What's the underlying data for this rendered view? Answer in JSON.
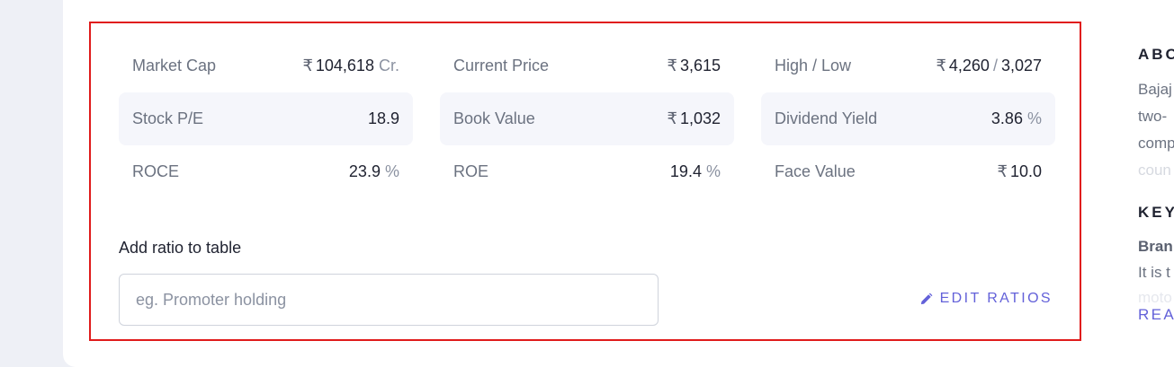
{
  "ratios": {
    "row1": {
      "c1": {
        "name": "Market Cap",
        "currency": "₹",
        "value": "104,618",
        "unit": "Cr."
      },
      "c2": {
        "name": "Current Price",
        "currency": "₹",
        "value": "3,615"
      },
      "c3": {
        "name": "High / Low",
        "currency": "₹",
        "high": "4,260",
        "sep": "/",
        "low": "3,027"
      }
    },
    "row2": {
      "c1": {
        "name": "Stock P/E",
        "value": "18.9"
      },
      "c2": {
        "name": "Book Value",
        "currency": "₹",
        "value": "1,032"
      },
      "c3": {
        "name": "Dividend Yield",
        "value": "3.86",
        "unit": "%"
      }
    },
    "row3": {
      "c1": {
        "name": "ROCE",
        "value": "23.9",
        "unit": "%"
      },
      "c2": {
        "name": "ROE",
        "value": "19.4",
        "unit": "%"
      },
      "c3": {
        "name": "Face Value",
        "currency": "₹",
        "value": "10.0"
      }
    }
  },
  "add_ratio": {
    "label": "Add ratio to table",
    "placeholder": "eg. Promoter holding",
    "value": ""
  },
  "edit_ratios": {
    "label": "EDIT RATIOS",
    "icon": "pencil-icon"
  },
  "side": {
    "about_heading": "ABO",
    "about_lines": [
      "Bajaj",
      "two-",
      "comp",
      "coun"
    ],
    "key_heading": "KEY",
    "key_bold": "Bran",
    "key_line": "It is t",
    "key_faded": "moto",
    "read_more": "REA"
  },
  "colors": {
    "accent": "#6361d9",
    "highlight_border": "#e01b1b",
    "row_shade": "#f5f6fb"
  }
}
